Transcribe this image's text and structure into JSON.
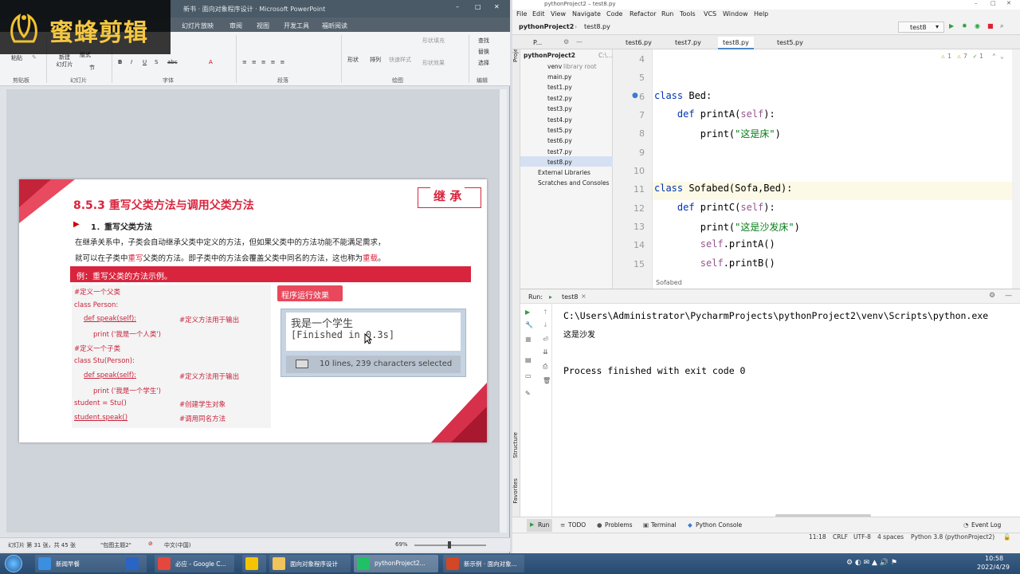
{
  "powerpoint": {
    "title": "新书 · 面向对象程序设计 · Microsoft PowerPoint",
    "tabs": [
      "幻灯片放映",
      "审阅",
      "视图",
      "开发工具",
      "福昕阅读"
    ],
    "logo_text": "蜜蜂剪辑",
    "ribbon": {
      "paste": "粘贴",
      "new_slide": "新建\n幻灯片",
      "layout": "版式",
      "section": "节",
      "shape": "形状",
      "arrange": "排列",
      "quick_styles": "快速样式",
      "shape_fill": "形状填充",
      "shape_effect": "形状效果",
      "find": "查找",
      "replace": "替换",
      "select": "选择",
      "groups": [
        "剪贴板",
        "幻灯片",
        "字体",
        "段落",
        "绘图",
        "编辑"
      ]
    },
    "slide": {
      "heading": "8.5.3  重写父类方法与调用父类方法",
      "badge": "继 承",
      "subheading": "1．重写父类方法",
      "para1": "在继承关系中，子类会自动继承父类中定义的方法，但如果父类中的方法功能不能满足需求，",
      "para2a": "就可以在子类中",
      "para2b": "重写",
      "para2c": "父类的方法。即子类中的方法会覆盖父类中同名的方法，这也称为",
      "para2d": "重载",
      "para2e": "。",
      "example_bar": "例：重写父类的方法示例。",
      "run_label": "程序运行效果",
      "code": [
        "#定义一个父类",
        "class Person:",
        "def speak(self):",
        "print ('我是一个人类')",
        "#定义一个子类",
        "class Stu(Person):",
        "def speak(self):",
        "print ('我是一个学生')",
        "student = Stu()",
        "student.speak()"
      ],
      "comments": [
        "#定义方法用于输出",
        "#定义方法用于输出",
        "#创建学生对象",
        "#调用同名方法"
      ],
      "output_line1": "我是一个学生",
      "output_line2": "[Finished in 0.3s]",
      "output_status": "10 lines, 239 characters selected"
    },
    "status": {
      "slide_info": "幻灯片 第 31 张，共 45 张",
      "theme": "\"包图主题2\"",
      "lang": "中文(中国)",
      "zoom": "69%"
    }
  },
  "pycharm": {
    "title": "pythonProject2 – test8.py",
    "menu": [
      "File",
      "Edit",
      "View",
      "Navigate",
      "Code",
      "Refactor",
      "Run",
      "Tools",
      "VCS",
      "Window",
      "Help"
    ],
    "breadcrumb": [
      "pythonProject2",
      "test8.py"
    ],
    "run_config": "test8",
    "project_label": "P...",
    "tabs": [
      "test6.py",
      "test7.py",
      "test8.py",
      "test5.py"
    ],
    "active_tab": "test8.py",
    "tree": {
      "root": "pythonProject2",
      "root_path": "C:\\...",
      "venv": "venv",
      "venv_note": "library root",
      "files": [
        "main.py",
        "test1.py",
        "test2.py",
        "test3.py",
        "test4.py",
        "test5.py",
        "test6.py",
        "test7.py",
        "test8.py"
      ],
      "external": "External Libraries",
      "scratches": "Scratches and Consoles"
    },
    "inspections": {
      "warn": "1",
      "weak": "7",
      "typo": "1"
    },
    "code": {
      "line_numbers": [
        "4",
        "5",
        "6",
        "7",
        "8",
        "9",
        "10",
        "11",
        "12",
        "13",
        "14",
        "15"
      ],
      "lines": [
        {
          "parts": [
            {
              "t": "",
              "c": ""
            }
          ]
        },
        {
          "parts": [
            {
              "t": "",
              "c": ""
            }
          ]
        },
        {
          "parts": [
            {
              "t": "class ",
              "c": "kw"
            },
            {
              "t": "Bed:",
              "c": ""
            }
          ]
        },
        {
          "parts": [
            {
              "t": "    def ",
              "c": "kw"
            },
            {
              "t": "printA(",
              "c": ""
            },
            {
              "t": "self",
              "c": "sf"
            },
            {
              "t": "):",
              "c": ""
            }
          ]
        },
        {
          "parts": [
            {
              "t": "        print(",
              "c": ""
            },
            {
              "t": "\"这是床\"",
              "c": "st"
            },
            {
              "t": ")",
              "c": ""
            }
          ]
        },
        {
          "parts": [
            {
              "t": "",
              "c": ""
            }
          ]
        },
        {
          "parts": [
            {
              "t": "",
              "c": ""
            }
          ]
        },
        {
          "parts": [
            {
              "t": "class ",
              "c": "kw"
            },
            {
              "t": "Sofabed(Sofa,Bed):",
              "c": ""
            }
          ]
        },
        {
          "parts": [
            {
              "t": "    def ",
              "c": "kw"
            },
            {
              "t": "printC(",
              "c": ""
            },
            {
              "t": "self",
              "c": "sf"
            },
            {
              "t": "):",
              "c": ""
            }
          ]
        },
        {
          "parts": [
            {
              "t": "        print(",
              "c": ""
            },
            {
              "t": "\"这是沙发床\"",
              "c": "st"
            },
            {
              "t": ")",
              "c": ""
            }
          ]
        },
        {
          "parts": [
            {
              "t": "        ",
              "c": ""
            },
            {
              "t": "self",
              "c": "sf"
            },
            {
              "t": ".printA()",
              "c": ""
            }
          ]
        },
        {
          "parts": [
            {
              "t": "        ",
              "c": ""
            },
            {
              "t": "self",
              "c": "sf"
            },
            {
              "t": ".printB()",
              "c": ""
            }
          ]
        }
      ],
      "breadcrumb_bottom": "Sofabed"
    },
    "run": {
      "label": "Run:",
      "tab": "test8",
      "cmd": "C:\\Users\\Administrator\\PycharmProjects\\pythonProject2\\venv\\Scripts\\python.exe",
      "out": "这是沙发",
      "exit": "Process finished with exit code 0"
    },
    "side_labels": [
      "Project",
      "Structure",
      "Favorites"
    ],
    "bottom_tabs": [
      "Run",
      "TODO",
      "Problems",
      "Terminal",
      "Python Console"
    ],
    "event_log": "Event Log",
    "status": {
      "position": "11:18",
      "line_sep": "CRLF",
      "encoding": "UTF-8",
      "indent": "4 spaces",
      "interpreter": "Python 3.8 (pythonProject2)"
    }
  },
  "taskbar": {
    "items": [
      {
        "label": "新闻早餐",
        "color": "#3b8ee0"
      },
      {
        "label": "",
        "color": "#2a64c4"
      },
      {
        "label": "必应 - Google C...",
        "color": "#e4473c"
      },
      {
        "label": "",
        "color": "#f4c400"
      },
      {
        "label": "面向对象程序设计",
        "color": "#f2c35b"
      },
      {
        "label": "pythonProject2...",
        "color": "#21c064"
      },
      {
        "label": "新示例 · 面向对象...",
        "color": "#d24726"
      }
    ],
    "time": "10:58",
    "date": "2022/4/29"
  }
}
